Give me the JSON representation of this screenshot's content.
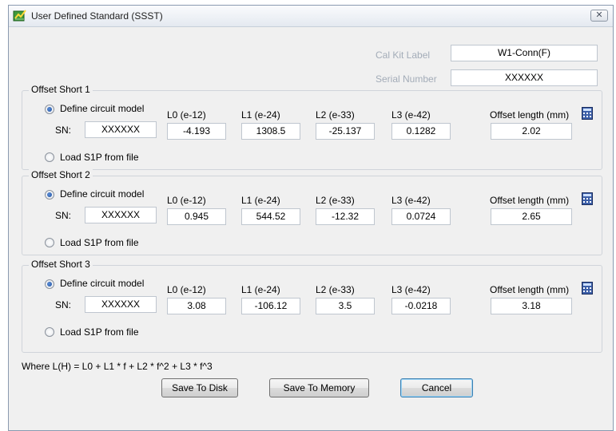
{
  "window": {
    "title": "User Defined Standard (SSST)",
    "close_glyph": "✕"
  },
  "header": {
    "cal_kit_label": "Cal Kit Label",
    "cal_kit_value": "W1-Conn(F)",
    "serial_number_label": "Serial Number",
    "serial_number_value": "XXXXXX"
  },
  "groups": [
    {
      "title": "Offset Short 1",
      "define_label": "Define circuit model",
      "define_checked": true,
      "sn_label": "SN:",
      "sn_value": "XXXXXX",
      "load_label": "Load S1P from file",
      "l0_label": "L0 (e-12)",
      "l0_value": "-4.193",
      "l1_label": "L1 (e-24)",
      "l1_value": "1308.5",
      "l2_label": "L2 (e-33)",
      "l2_value": "-25.137",
      "l3_label": "L3 (e-42)",
      "l3_value": "0.1282",
      "offset_label": "Offset length (mm)",
      "offset_value": "2.02"
    },
    {
      "title": "Offset Short 2",
      "define_label": "Define circuit model",
      "define_checked": true,
      "sn_label": "SN:",
      "sn_value": "XXXXXX",
      "load_label": "Load S1P from file",
      "l0_label": "L0 (e-12)",
      "l0_value": "0.945",
      "l1_label": "L1 (e-24)",
      "l1_value": "544.52",
      "l2_label": "L2 (e-33)",
      "l2_value": "-12.32",
      "l3_label": "L3 (e-42)",
      "l3_value": "0.0724",
      "offset_label": "Offset length (mm)",
      "offset_value": "2.65"
    },
    {
      "title": "Offset Short 3",
      "define_label": "Define circuit model",
      "define_checked": true,
      "sn_label": "SN:",
      "sn_value": "XXXXXX",
      "load_label": "Load S1P from file",
      "l0_label": "L0 (e-12)",
      "l0_value": "3.08",
      "l1_label": "L1 (e-24)",
      "l1_value": "-106.12",
      "l2_label": "L2 (e-33)",
      "l2_value": "3.5",
      "l3_label": "L3 (e-42)",
      "l3_value": "-0.0218",
      "offset_label": "Offset length (mm)",
      "offset_value": "3.18"
    }
  ],
  "formula": "Where L(H) = L0 + L1 * f + L2 * f^2 + L3 * f^3",
  "buttons": {
    "save_disk": "Save To Disk",
    "save_memory": "Save To Memory",
    "cancel": "Cancel"
  }
}
